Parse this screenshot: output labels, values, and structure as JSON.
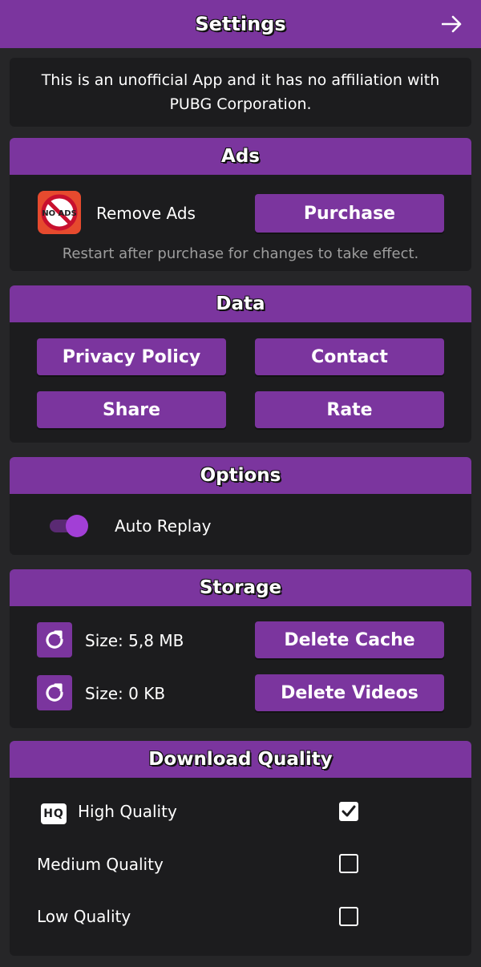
{
  "header": {
    "title": "Settings",
    "forward_icon": "arrow-right-icon"
  },
  "disclaimer": "This is an unofficial App and it has no affiliation with PUBG Corporation.",
  "ads": {
    "title": "Ads",
    "icon_text": "NO ADS",
    "remove_label": "Remove Ads",
    "purchase_label": "Purchase",
    "note": "Restart after purchase for changes to take effect."
  },
  "data_section": {
    "title": "Data",
    "privacy_label": "Privacy Policy",
    "contact_label": "Contact",
    "share_label": "Share",
    "rate_label": "Rate"
  },
  "options": {
    "title": "Options",
    "auto_replay_label": "Auto Replay",
    "auto_replay_on": true
  },
  "storage": {
    "title": "Storage",
    "cache_size": "Size: 5,8 MB",
    "delete_cache_label": "Delete Cache",
    "videos_size": "Size: 0 KB",
    "delete_videos_label": "Delete Videos"
  },
  "download_quality": {
    "title": "Download Quality",
    "hq_badge": "HQ",
    "options": [
      {
        "label": "High Quality",
        "checked": true
      },
      {
        "label": "Medium Quality",
        "checked": false
      },
      {
        "label": "Low Quality",
        "checked": false
      }
    ]
  },
  "colors": {
    "accent": "#7b359e",
    "background": "#262628",
    "card": "#1c1c1e"
  }
}
